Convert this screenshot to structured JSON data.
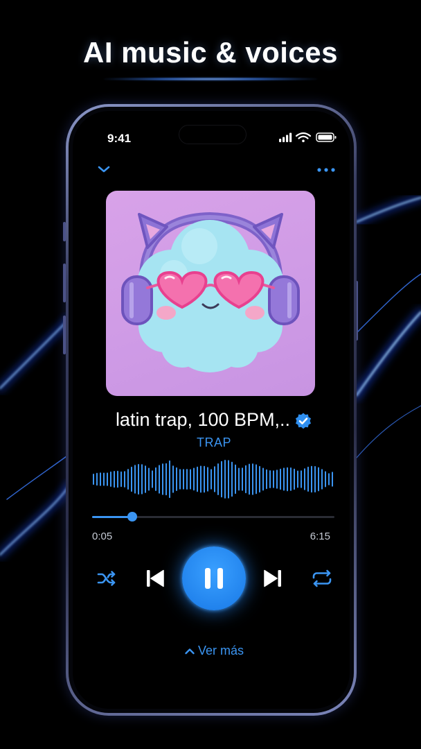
{
  "headline": "AI music & voices",
  "status_bar": {
    "time": "9:41"
  },
  "player": {
    "title": "latin trap, 100 BPM,..",
    "genre": "TRAP",
    "elapsed": "0:05",
    "duration": "6:15",
    "progress": 0.165,
    "see_more": "Ver más"
  },
  "icons": {
    "collapse": "chevron-down-icon",
    "menu": "more-horizontal-icon",
    "verified": "verified-badge-icon",
    "shuffle": "shuffle-icon",
    "previous": "skip-previous-icon",
    "pause": "pause-icon",
    "next": "skip-next-icon",
    "repeat": "repeat-icon",
    "see_more": "chevron-up-icon"
  },
  "colors": {
    "accent": "#3b95f2",
    "background": "#000000",
    "album_bg": "#cf9be6"
  }
}
